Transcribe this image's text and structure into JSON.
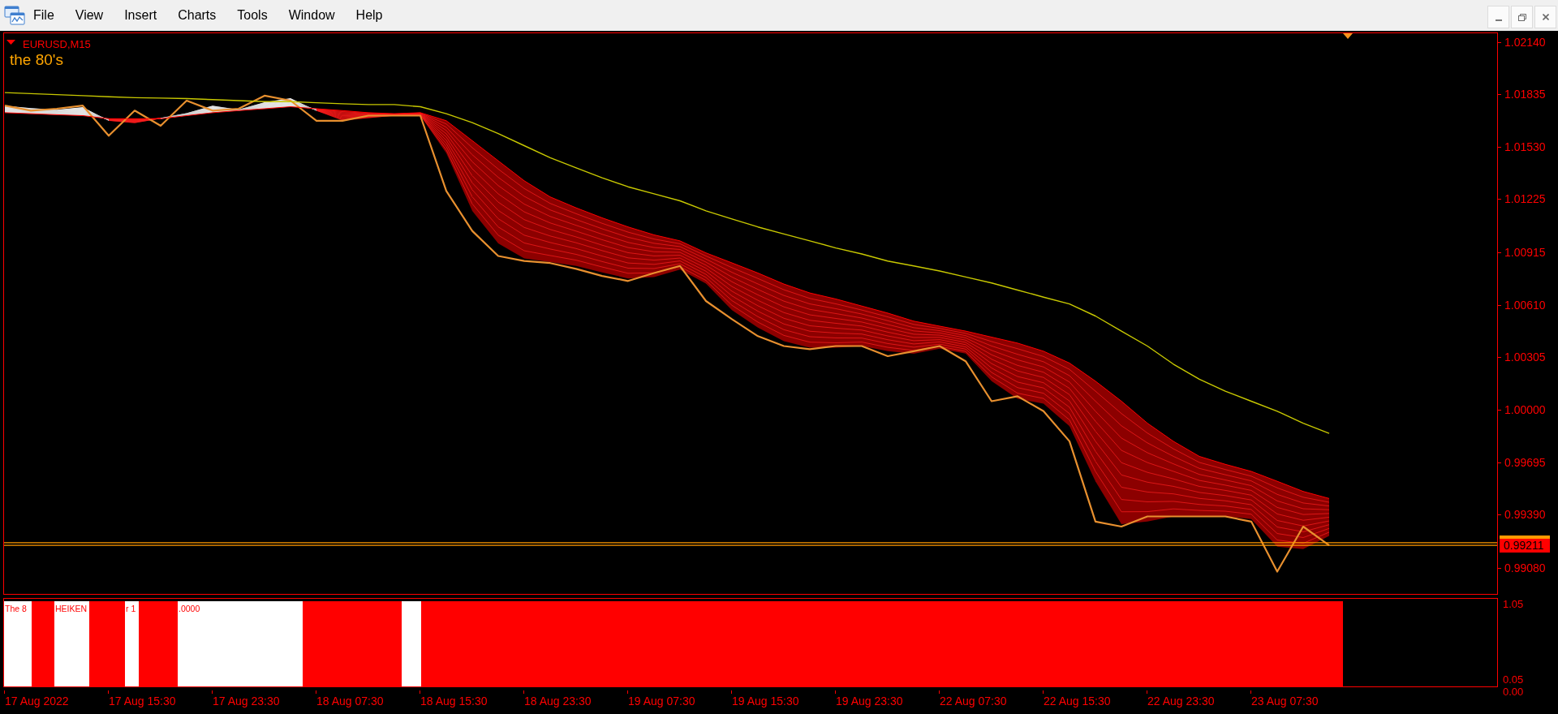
{
  "menu_bar": {
    "items": [
      "File",
      "View",
      "Insert",
      "Charts",
      "Tools",
      "Window",
      "Help"
    ]
  },
  "window_controls": [
    {
      "kind": "minimize"
    },
    {
      "kind": "restore"
    },
    {
      "kind": "close"
    }
  ],
  "chart": {
    "symbol": "EURUSD,M15",
    "title": "the 80's",
    "chart_data": {
      "type": "line",
      "categories": [
        null,
        null,
        null,
        null,
        null,
        null,
        null,
        null,
        null,
        null,
        null,
        null,
        null,
        null,
        null,
        null,
        null,
        null,
        null,
        null,
        null,
        null,
        null,
        null,
        null,
        null,
        null,
        null,
        null,
        null,
        null,
        null,
        null,
        null,
        null,
        null,
        null,
        null,
        null,
        null,
        null,
        null,
        null,
        null,
        null,
        null,
        null,
        null,
        null,
        null,
        null,
        null
      ],
      "ylim": [
        0.98928,
        1.0219
      ],
      "yticks": [
        {
          "value": 1.0214,
          "label": "1.02140"
        },
        {
          "value": 1.01835,
          "label": "1.01835"
        },
        {
          "value": 1.0153,
          "label": "1.01530"
        },
        {
          "value": 1.01225,
          "label": "1.01225"
        },
        {
          "value": 1.00915,
          "label": "1.00915"
        },
        {
          "value": 1.0061,
          "label": "1.00610"
        },
        {
          "value": 1.00305,
          "label": "1.00305"
        },
        {
          "value": 1.0,
          "label": "1.00000"
        },
        {
          "value": 0.99695,
          "label": "0.99695"
        },
        {
          "value": 0.9939,
          "label": "0.99390"
        },
        {
          "value": 0.9908,
          "label": "0.99080"
        }
      ],
      "series": [
        {
          "color": "#e8902f",
          "values": [
            1.01769,
            1.0174,
            1.01751,
            1.01769,
            1.01594,
            1.0174,
            1.01652,
            1.01798,
            1.0174,
            1.01751,
            1.01827,
            1.01798,
            1.01681,
            1.01681,
            1.01711,
            1.01711,
            1.01711,
            1.01273,
            1.0104,
            1.00894,
            1.00865,
            1.00853,
            1.00819,
            1.00778,
            1.00749,
            1.00795,
            1.00836,
            1.00632,
            1.00527,
            1.00428,
            1.0037,
            1.00352,
            1.0037,
            1.0037,
            1.00311,
            1.0034,
            1.0037,
            1.00282,
            1.00049,
            1.00078,
            0.99991,
            0.99816,
            0.99349,
            0.9932,
            0.99379,
            0.99379,
            0.99379,
            0.99379,
            0.99349,
            0.99058,
            0.9932,
            0.99211
          ]
        },
        {
          "color": "#c8c800",
          "values": [
            1.01845,
            1.01839,
            1.01833,
            1.01827,
            1.01821,
            1.01815,
            1.01813,
            1.0181,
            1.01804,
            1.01798,
            1.01792,
            1.01792,
            1.01786,
            1.0178,
            1.01775,
            1.01775,
            1.01763,
            1.01722,
            1.0167,
            1.01606,
            1.01536,
            1.01466,
            1.01407,
            1.01349,
            1.01297,
            1.01256,
            1.01215,
            1.01157,
            1.0111,
            1.01063,
            1.01022,
            1.00982,
            1.00941,
            1.00906,
            1.00865,
            1.00836,
            1.00807,
            1.00772,
            1.00737,
            1.00696,
            1.00655,
            1.00615,
            1.00545,
            1.00457,
            1.0037,
            1.00265,
            1.00177,
            1.00107,
            1.00049,
            0.99991,
            0.99921,
            0.99862
          ]
        },
        {
          "color": "#ff0000",
          "values": [
            1.01728,
            1.01722,
            1.01716,
            1.01711,
            1.01693,
            1.01693,
            1.01693,
            1.01711,
            1.01728,
            1.0174,
            1.01751,
            1.01763,
            1.01751,
            1.0174,
            1.01728,
            1.01722,
            1.01728,
            1.01681,
            1.01565,
            1.01448,
            1.01332,
            1.01238,
            1.01174,
            1.01116,
            1.01063,
            1.01017,
            1.00982,
            1.00912,
            1.00854,
            1.00795,
            1.00731,
            1.00679,
            1.00644,
            1.00603,
            1.00562,
            1.00515,
            1.00486,
            1.00457,
            1.00422,
            1.00387,
            1.0034,
            1.00271,
            1.00166,
            1.00049,
            0.99921,
            0.99816,
            0.99728,
            0.99682,
            0.99641,
            0.99583,
            0.99524,
            0.99483
          ]
        }
      ],
      "ref_lines": [
        {
          "axis": "y",
          "value": 0.99226
        },
        {
          "axis": "y",
          "value": 0.99211,
          "label": "0.99211"
        }
      ]
    }
  },
  "subwindow": {
    "label_parts": [
      "The 8",
      "HEIKEN",
      "r 1",
      ".0000"
    ],
    "axis_labels": [
      "1.05",
      "0.05",
      "0.00"
    ]
  },
  "time_axis": {
    "labels": [
      "17 Aug 2022",
      "17 Aug 15:30",
      "17 Aug 23:30",
      "18 Aug 07:30",
      "18 Aug 15:30",
      "18 Aug 23:30",
      "19 Aug 07:30",
      "19 Aug 15:30",
      "19 Aug 23:30",
      "22 Aug 07:30",
      "22 Aug 15:30",
      "22 Aug 23:30",
      "23 Aug 07:30"
    ]
  }
}
